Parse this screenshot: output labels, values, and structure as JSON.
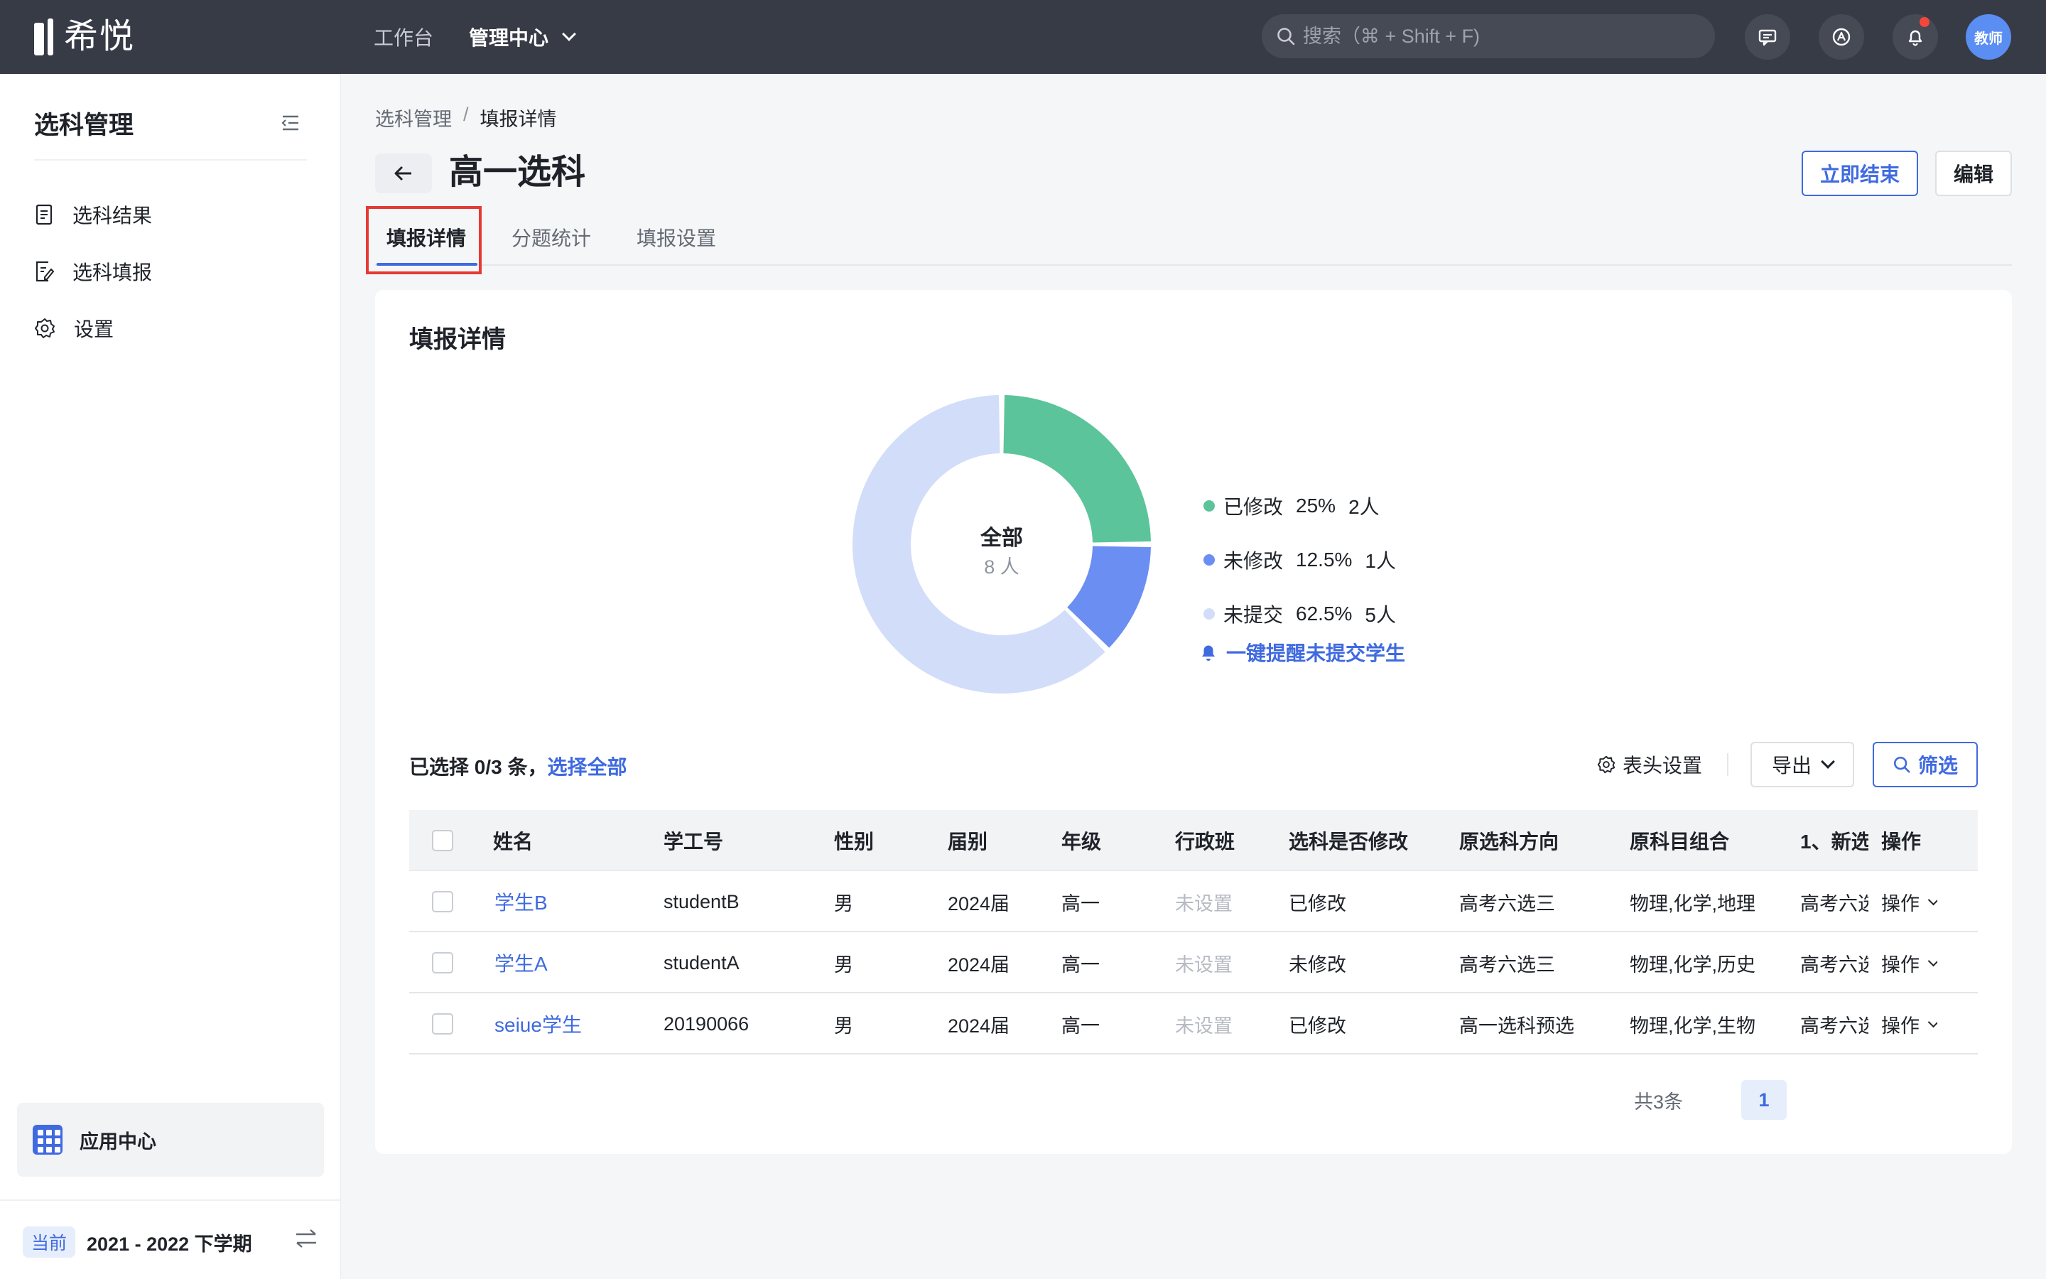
{
  "app": {
    "logo_text": "希悦",
    "nav": [
      {
        "label": "工作台"
      },
      {
        "label": "管理中心"
      }
    ],
    "search_placeholder": "搜索（⌘ + Shift + F)",
    "avatar_label": "教师",
    "icons": [
      "message-icon",
      "app-switch-icon",
      "bell-icon"
    ],
    "notification_dot_color": "#f5463b"
  },
  "sidebar": {
    "title": "选科管理",
    "items": [
      {
        "label": "选科结果",
        "icon": "document-icon"
      },
      {
        "label": "选科填报",
        "icon": "edit-form-icon"
      },
      {
        "label": "设置",
        "icon": "gear-icon"
      }
    ],
    "app_center": "应用中心",
    "term_tag": "当前",
    "term_value": "2021 - 2022 下学期"
  },
  "page": {
    "breadcrumb": [
      "选科管理",
      "填报详情"
    ],
    "breadcrumb_sep": "/",
    "title": "高一选科",
    "end_button": "立即结束",
    "edit_button": "编辑",
    "tabs": [
      {
        "label": "填报详情",
        "active": true
      },
      {
        "label": "分题统计",
        "active": false
      },
      {
        "label": "填报设置",
        "active": false
      }
    ]
  },
  "card": {
    "title": "填报详情",
    "remind_label": "一键提醒未提交学生",
    "selection": {
      "prefix": "已选择 0/3 条，",
      "select_all": "选择全部"
    },
    "header_setting": "表头设置",
    "export": "导出",
    "filter": "筛选"
  },
  "chart_data": {
    "type": "pie",
    "donut": true,
    "center_label": "全部",
    "center_value": "8 人",
    "slices": [
      {
        "name": "已修改",
        "percent": "25%",
        "count": "2人",
        "value": 2,
        "color": "#5cc49a"
      },
      {
        "name": "未修改",
        "percent": "12.5%",
        "count": "1人",
        "value": 1,
        "color": "#6b8ef2"
      },
      {
        "name": "未提交",
        "percent": "62.5%",
        "count": "5人",
        "value": 5,
        "color": "#d2ddf9"
      }
    ]
  },
  "table": {
    "columns": [
      "姓名",
      "学工号",
      "性别",
      "届别",
      "年级",
      "行政班",
      "选科是否修改",
      "原选科方向",
      "原科目组合",
      "1、新选",
      "操作"
    ],
    "rows": [
      {
        "name": "学生B",
        "id": "studentB",
        "gender": "男",
        "cohort": "2024届",
        "grade": "高一",
        "class": "未设置",
        "modified": "已修改",
        "direction": "高考六选三",
        "combo": "物理,化学,地理",
        "new_choice": "高考六选",
        "op": "操作"
      },
      {
        "name": "学生A",
        "id": "studentA",
        "gender": "男",
        "cohort": "2024届",
        "grade": "高一",
        "class": "未设置",
        "modified": "未修改",
        "direction": "高考六选三",
        "combo": "物理,化学,历史",
        "new_choice": "高考六选",
        "op": "操作"
      },
      {
        "name": "seiue学生",
        "id": "20190066",
        "gender": "男",
        "cohort": "2024届",
        "grade": "高一",
        "class": "未设置",
        "modified": "已修改",
        "direction": "高一选科预选",
        "combo": "物理,化学,生物",
        "new_choice": "高考六选",
        "op": "操作"
      }
    ],
    "total": "共3条",
    "current_page": "1"
  }
}
